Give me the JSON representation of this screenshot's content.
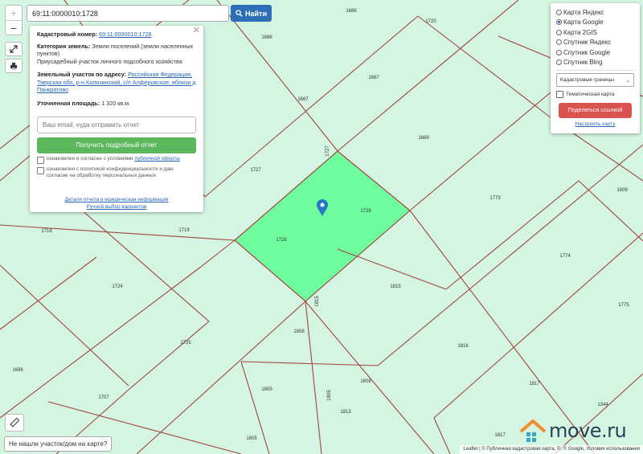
{
  "search": {
    "value": "69:11:0000010:1728",
    "button_label": "Найти"
  },
  "zoom": {
    "in": "+",
    "out": "−"
  },
  "info": {
    "cad_label": "Кадастровый номер:",
    "cad_value": "69:11:0000010:1728",
    "cat_label": "Категория земель:",
    "cat_value": "Земли поселений (земли населенных пунктов)",
    "use_value": "Приусадебный участок личного подсобного хозяйства",
    "addr_label": "Земельный участок по адресу:",
    "addr_value": "Российская Федерация, Тверская обл, р-н Калязинский, с/п Алферовское, вблизи д Панкратово",
    "area_label": "Уточненная площадь:",
    "area_value": "1 320 кв.м.",
    "email_placeholder": "Ваш email, куда отправить отчет",
    "report_button": "Получить подробный отчет",
    "agree1_text": "ознакомлен и согласен с условиями",
    "agree1_link": "публичной оферты",
    "agree2_text": "ознакомлен с политикой конфиденциальности и даю согласие на обработку персональных данных",
    "details_link": "Детали отчета и юридическая информация",
    "manual_link": "Ручной выбор вариантов"
  },
  "layers": {
    "options": [
      "Карта Яндекс",
      "Карта Google",
      "Карта 2GIS",
      "Спутник Яндекс",
      "Спутник Google",
      "Спутник Bing"
    ],
    "selected": "Карта Google",
    "bounds_select": "Кадастровые границы",
    "thematic": "Тематическая карта",
    "share_button": "Поделиться ссылкой",
    "setup_link": "Настроить карту"
  },
  "not_found_button": "Не нашли участок/дом на карте?",
  "attribution": "Leaflet | © Публичная кадастровая карта, ©, © Google, Условия использования",
  "logo_text": "move.ru",
  "colors": {
    "map_bg": "#d4f5e1",
    "boundary": "#a0463f",
    "selected_parcel": "#6ffc9f",
    "marker": "#2878c8",
    "search_button": "#2c6fb7",
    "report_button": "#5cb85c",
    "share_button": "#d9534f"
  },
  "map_labels": [
    "1686",
    "1720",
    "1686",
    "1687",
    "1687",
    "1688",
    "1727",
    "1727",
    "1728",
    "1728",
    "1773",
    "1809",
    "1718",
    "1719",
    "1774",
    "1724",
    "1815",
    "1815",
    "1775",
    "1808",
    "1725",
    "1816",
    "1696",
    "1707",
    "1805",
    "1805",
    "1808",
    "1817",
    "1344",
    "1813",
    "1805",
    "1817",
    "1707"
  ]
}
